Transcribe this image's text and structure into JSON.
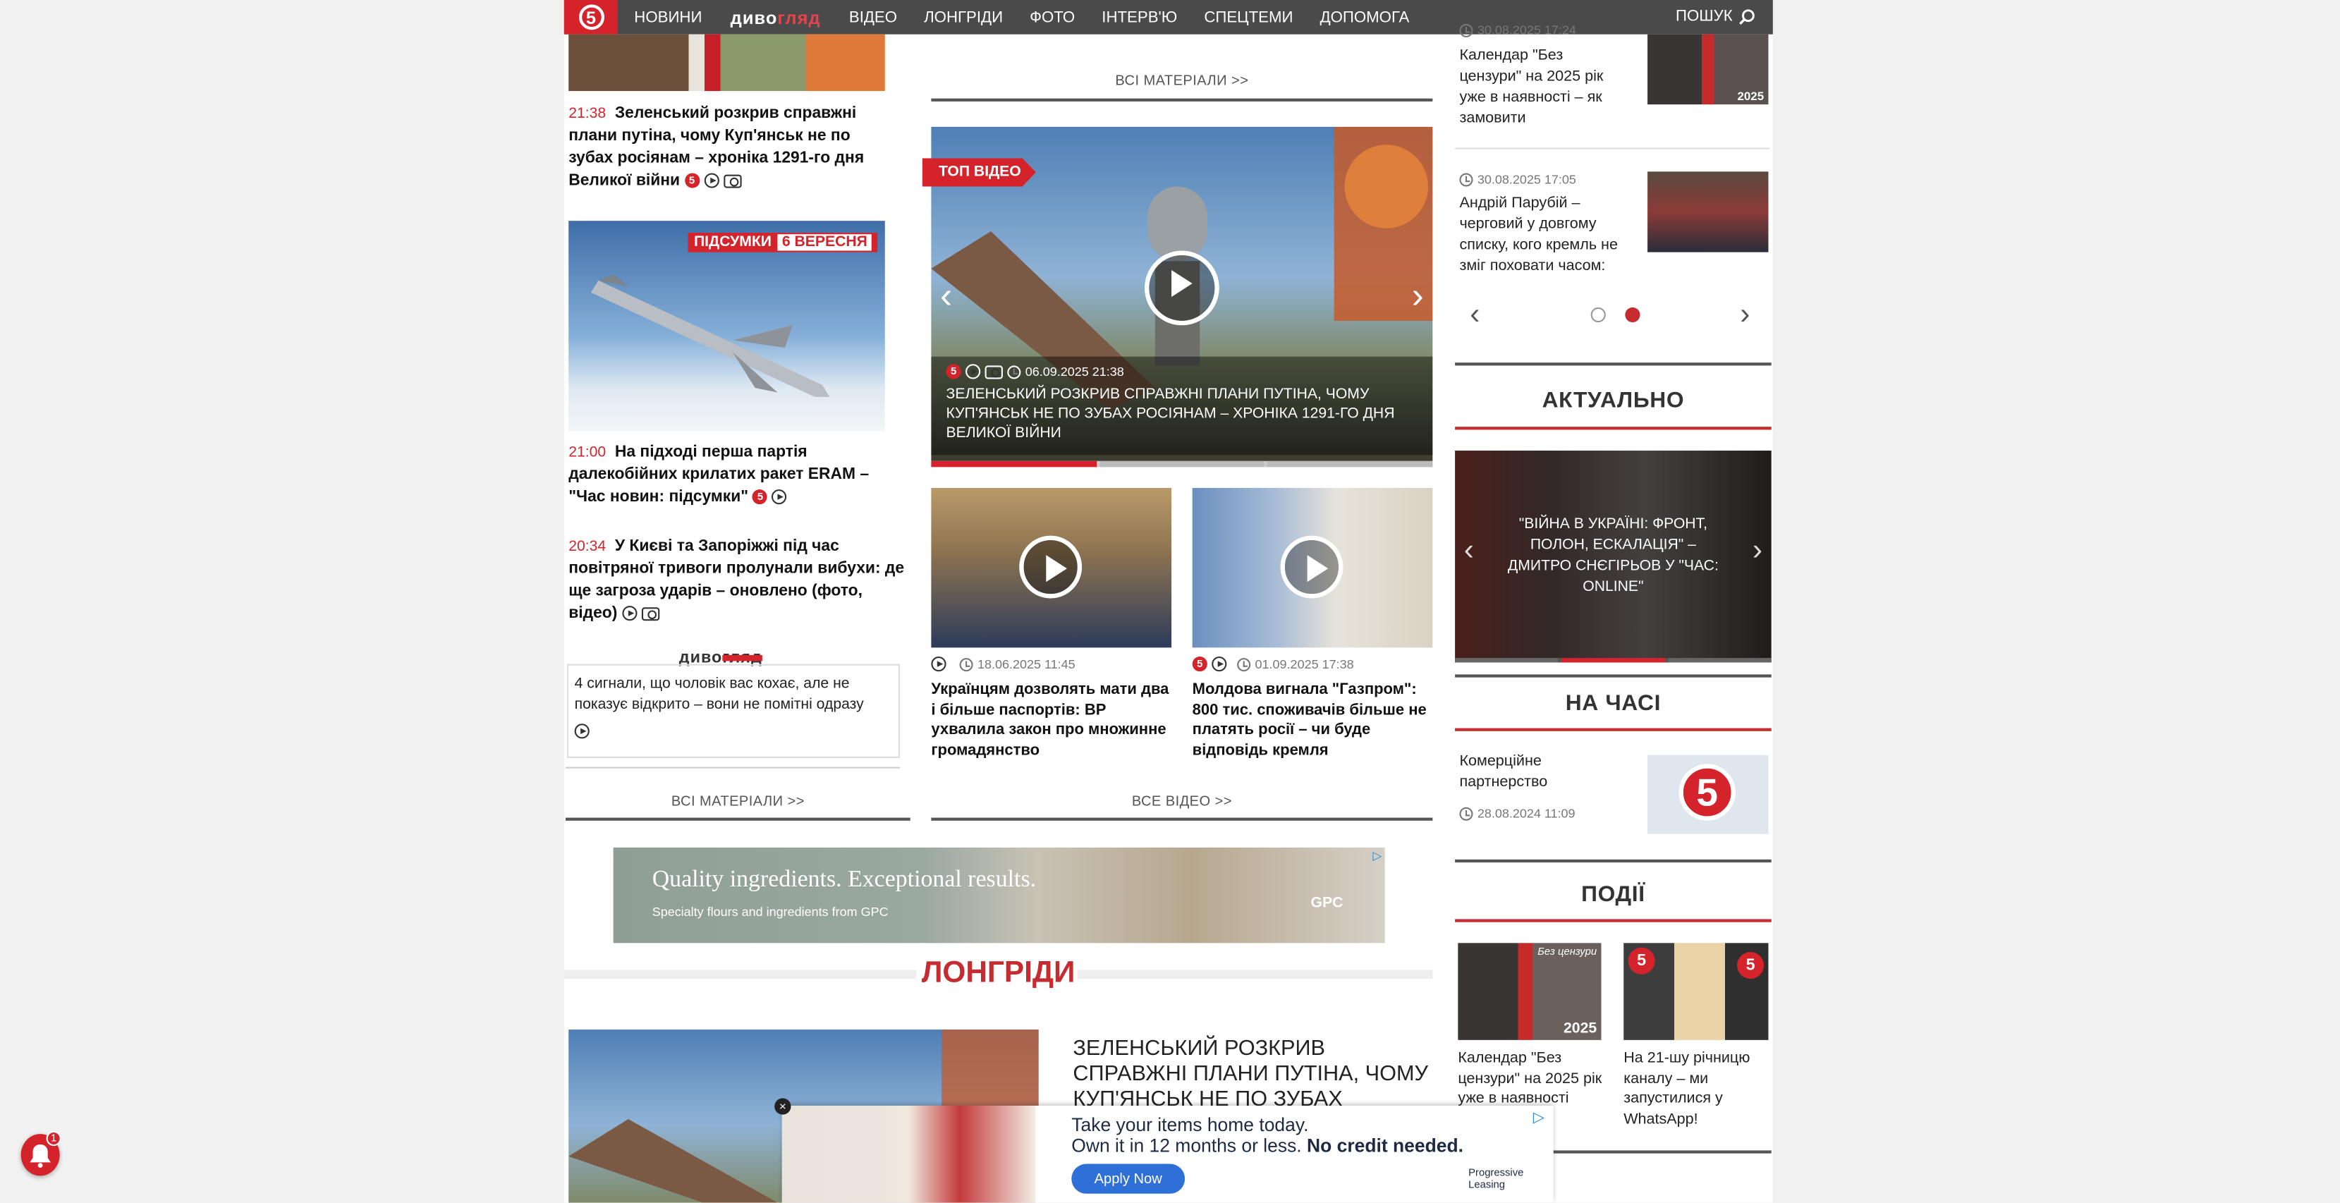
{
  "nav": {
    "logo": "5",
    "items": [
      "НОВИНИ",
      "ВІДЕО",
      "ЛОНГРІДИ",
      "ФОТО",
      "ІНТЕРВ'Ю",
      "СПЕЦТЕМИ",
      "ДОПОМОГА"
    ],
    "brand_part1": "диво",
    "brand_part2": "гляд",
    "search_label": "ПОШУК"
  },
  "left_col": {
    "news": [
      {
        "time": "21:38",
        "title": "Зеленський розкрив справжні плани путіна, чому Куп'янськ не по зубах росіянам – хроніка 1291-го дня Великої війни"
      },
      {
        "time": "21:00",
        "title": "На підході перша партія далекобійних крилатих ракет ERAM – \"Час новин: підсумки\""
      },
      {
        "time": "20:34",
        "title": "У Києві та Запоріжжі під час повітряної тривоги пролунали вибухи: де ще загроза ударів – оновлено (фото, відео)"
      }
    ],
    "banner_label": "ПІДСУМКИ",
    "banner_date": "6 ВЕРЕСНЯ",
    "divogliad_part1": "диво",
    "divogliad_part2": "гляд",
    "divogliad_text": "4 сигнали, що чоловік вас кохає, але не показує відкрито – вони не помітні одразу",
    "all_materials": "ВСІ МАТЕРІАЛИ  >>"
  },
  "center_col": {
    "all_materials_top": "ВСІ МАТЕРІАЛИ  >>",
    "top_video_badge": "ТОП ВІДЕО",
    "top_video_date": "06.09.2025 21:38",
    "top_video_title": "ЗЕЛЕНСЬКИЙ РОЗКРИВ СПРАВЖНІ ПЛАНИ ПУТІНА, ЧОМУ КУП'ЯНСЬК НЕ ПО ЗУБАХ РОСІЯНАМ – ХРОНІКА 1291-ГО ДНЯ ВЕЛИКОЇ ВІЙНИ",
    "videos": [
      {
        "date": "18.06.2025 11:45",
        "title": "Українцям дозволять мати два і більше паспортів: ВР ухвалила закон про множинне громадянство"
      },
      {
        "date": "01.09.2025 17:38",
        "title": "Молдова вигнала \"Газпром\": 800 тис. споживачів більше не платять росії – чи буде відповідь кремля"
      }
    ],
    "all_videos": "ВСЕ ВІДЕО  >>"
  },
  "right_col": {
    "slider_items": [
      {
        "date": "30.08.2025 17:24",
        "title": "Календар \"Без цензури\" на 2025 рік уже в наявності – як замовити"
      },
      {
        "date": "30.08.2025 17:05",
        "title": "Андрій Парубій – черговий у довгому списку, кого кремль не зміг поховати часом:"
      }
    ],
    "aktualno_title": "АКТУАЛЬНО",
    "aktualno_caption": "\"ВІЙНА В УКРАЇНІ: ФРОНТ, ПОЛОН, ЕСКАЛАЦІЯ\" – ДМИТРО СНЄГІРЬОВ У \"ЧАС: ONLINE\"",
    "na_chasi_title": "НА ЧАСІ",
    "na_chasi_item": {
      "title": "Комерційне партнерство",
      "date": "28.08.2024 11:09"
    },
    "podii_title": "ПОДІЇ",
    "podii_items": [
      {
        "title": "Календар \"Без цензури\" на 2025 рік уже в наявності",
        "img_text": "Без цензури",
        "year": "2025"
      },
      {
        "title": "На 21-шу річницю каналу – ми запустилися у WhatsApp!"
      }
    ]
  },
  "ad_banner": {
    "headline": "Quality ingredients. Exceptional results.",
    "sub": "Specialty flours and ingredients from GPC",
    "brand": "GPC"
  },
  "longreads": {
    "title": "ЛОНГРІДИ",
    "headline": "ЗЕЛЕНСЬКИЙ РОЗКРИВ СПРАВЖНІ ПЛАНИ ПУТІНА, ЧОМУ КУП'ЯНСЬК НЕ ПО ЗУБАХ РОСІЯНАМ –"
  },
  "bottom_ad": {
    "line1": "Take your items home today.",
    "line2": "Own it in 12 months or less.",
    "line2_bold": "No credit needed.",
    "button": "Apply Now",
    "brand": "Progressive Leasing"
  },
  "notification": {
    "count": "1"
  },
  "colors": {
    "brand_red": "#d5232b",
    "nav_bg": "#4a4a4a"
  }
}
